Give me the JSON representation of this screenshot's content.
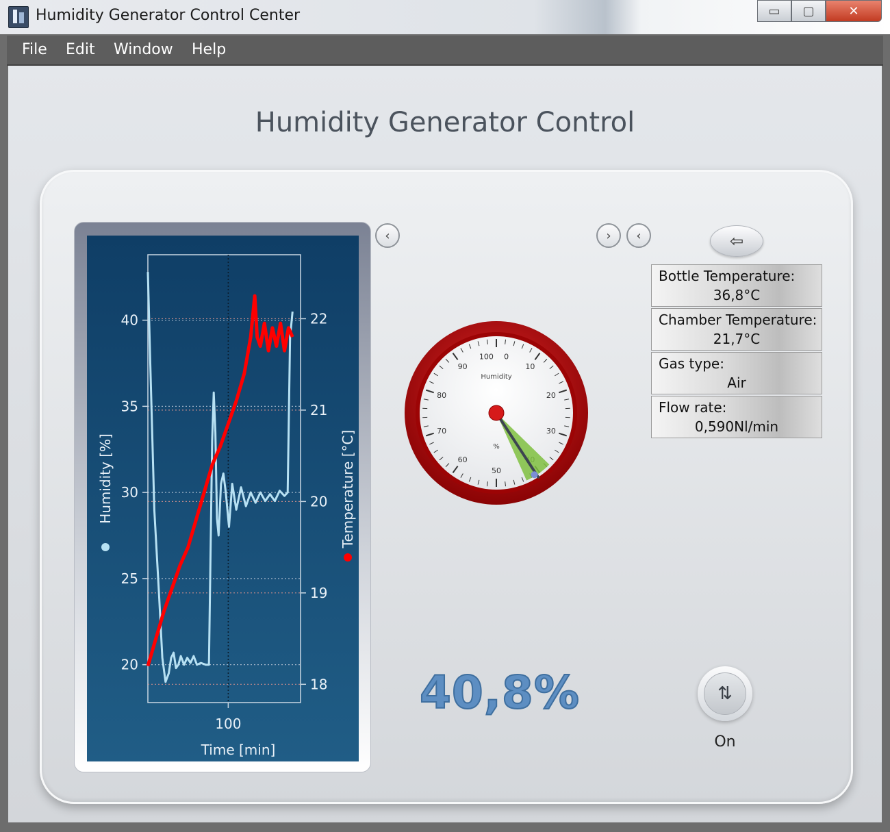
{
  "window": {
    "title": "Humidity Generator Control Center",
    "buttons": {
      "minimize": "▭",
      "maximize": "▢",
      "close": "✕"
    }
  },
  "menu": [
    {
      "label": "File"
    },
    {
      "label": "Edit"
    },
    {
      "label": "Window"
    },
    {
      "label": "Help"
    }
  ],
  "page": {
    "title": "Humidity Generator Control"
  },
  "nav": {
    "prev_left": "‹",
    "next": "›",
    "prev_right": "‹",
    "back": "⇦"
  },
  "info": {
    "bottle_temperature": {
      "label": "Bottle Temperature:",
      "value": "36,8°C"
    },
    "chamber_temperature": {
      "label": "Chamber Temperature:",
      "value": "21,7°C"
    },
    "gas_type": {
      "label": "Gas type:",
      "value": "Air"
    },
    "flow_rate": {
      "label": "Flow rate:",
      "value": "0,590Nl/min"
    }
  },
  "gauge": {
    "title": "Humidity",
    "unit": "%",
    "value": 40.8,
    "min": 0,
    "max": 100,
    "tick_labels": [
      "100",
      "0",
      "10",
      "20",
      "30",
      "40",
      "50",
      "60",
      "70",
      "80",
      "90"
    ]
  },
  "readout": {
    "value": "40,8%"
  },
  "power": {
    "icon": "up-down-arrows-icon",
    "glyph": "⇅",
    "label": "On"
  },
  "colors": {
    "humidity": "#b7e1f3",
    "temperature": "#ff0000",
    "gauge_ring": "#b5090a",
    "readout": "#5d8ec2"
  },
  "chart_data": {
    "type": "line",
    "xlabel": "Time [min]",
    "ylabel_left": "Humidity [%]",
    "ylabel_right": "Temperature [°C]",
    "xlim": [
      0,
      190
    ],
    "x_ticks": [
      100
    ],
    "ylim_left": [
      17.8,
      43.8
    ],
    "ylim_right": [
      17.8,
      22.7
    ],
    "y_ticks_left": [
      20,
      25,
      30,
      35,
      40
    ],
    "y_ticks_right": [
      18,
      19,
      20,
      21,
      22
    ],
    "grid": true,
    "series": [
      {
        "name": "Humidity [%]",
        "axis": "left",
        "color": "#b7e1f3",
        "x": [
          0,
          3,
          8,
          14,
          18,
          22,
          26,
          29,
          32,
          35,
          38,
          41,
          45,
          49,
          53,
          57,
          61,
          66,
          72,
          76,
          80,
          82,
          84,
          86,
          88,
          91,
          94,
          97,
          101,
          105,
          110,
          116,
          122,
          128,
          134,
          140,
          146,
          152,
          158,
          164,
          170,
          174,
          177,
          180
        ],
        "y": [
          42.8,
          37.5,
          29,
          24,
          20.4,
          19,
          19.5,
          20.4,
          20.7,
          19.8,
          20,
          20.5,
          20,
          20.4,
          20.1,
          20.5,
          20,
          20.1,
          20,
          20,
          33,
          35.8,
          33.5,
          28.5,
          27.5,
          30.5,
          31.1,
          30,
          28,
          30.5,
          29,
          30.3,
          29.2,
          30,
          29.4,
          30,
          29.5,
          29.9,
          29.5,
          30.1,
          29.8,
          30,
          39,
          40.5
        ]
      },
      {
        "name": "Temperature [°C]",
        "axis": "right",
        "color": "#ff0000",
        "x": [
          0,
          10,
          20,
          30,
          40,
          50,
          60,
          70,
          80,
          90,
          100,
          110,
          120,
          128,
          133,
          136,
          140,
          145,
          150,
          155,
          160,
          165,
          170,
          175,
          180
        ],
        "y": [
          18.2,
          18.5,
          18.8,
          19.05,
          19.3,
          19.5,
          19.8,
          20.1,
          20.4,
          20.6,
          20.85,
          21.1,
          21.4,
          21.8,
          22.25,
          21.8,
          21.7,
          21.95,
          21.65,
          21.9,
          21.7,
          21.95,
          21.65,
          21.9,
          21.8
        ]
      }
    ]
  }
}
